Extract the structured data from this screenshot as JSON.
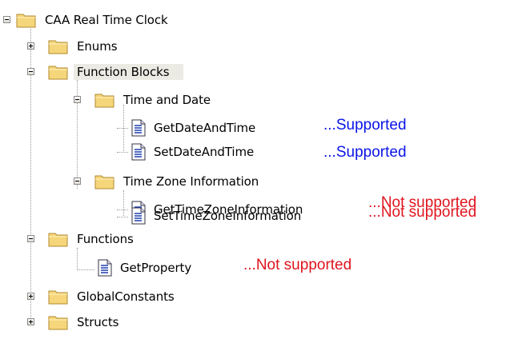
{
  "tree": {
    "root": {
      "label": "CAA Real Time Clock",
      "expanded": true
    },
    "enums": {
      "label": "Enums",
      "expanded": false
    },
    "function_blocks": {
      "label": "Function Blocks",
      "expanded": true,
      "selected": true
    },
    "time_and_date": {
      "label": "Time and Date",
      "expanded": true
    },
    "get_date_and_time": {
      "label": "GetDateAndTime",
      "status": "...Supported"
    },
    "set_date_and_time": {
      "label": "SetDateAndTime",
      "status": "...Supported"
    },
    "time_zone_information": {
      "label": "Time Zone Information",
      "expanded": true
    },
    "get_time_zone_information": {
      "label": "GetTimeZoneInformation",
      "status": "...Not supported"
    },
    "set_time_zone_information": {
      "label": "SetTimeZoneInformation",
      "status": "...Not supported"
    },
    "functions": {
      "label": "Functions",
      "expanded": true
    },
    "get_property": {
      "label": "GetProperty",
      "status": "...Not supported"
    },
    "global_constants": {
      "label": "GlobalConstants",
      "expanded": false
    },
    "structs": {
      "label": "Structs",
      "expanded": false
    }
  },
  "colors": {
    "supported": "#0a14e6",
    "not_supported": "#e0141e",
    "selection": "#ecebe3",
    "folder_fill": "#f6d67a",
    "folder_edge": "#b08a2e",
    "doc_lines": "#1e3fb0"
  },
  "icons": {
    "folder": "folder-icon",
    "document": "document-icon",
    "expander_expanded": "minus-box-icon",
    "expander_collapsed": "plus-box-icon"
  }
}
